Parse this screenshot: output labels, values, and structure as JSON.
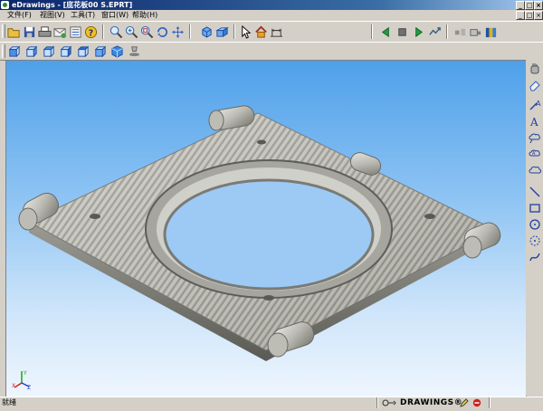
{
  "window": {
    "title": "eDrawings - [底花板00 S.EPRT]",
    "min_glyph": "_",
    "max_glyph": "□",
    "close_glyph": "×"
  },
  "menu": {
    "items": [
      "文件(F)",
      "视图(V)",
      "工具(T)",
      "窗口(W)",
      "帮助(H)"
    ],
    "mdi_min": "_",
    "mdi_max": "□",
    "mdi_close": "×"
  },
  "toolbar": {
    "main": [
      "open-icon",
      "save-icon",
      "print-icon",
      "send-icon",
      "options-icon",
      "help-icon",
      "zoom-fit-icon",
      "zoom-in-icon",
      "zoom-area-icon",
      "rotate-icon",
      "pan-icon",
      "view-3d-icon",
      "view-orient-icon",
      "select-icon",
      "home-icon",
      "measure-icon"
    ],
    "animation": [
      "play-back-icon",
      "stop-icon",
      "play-icon",
      "loop-icon"
    ],
    "misc": [
      "explode-icon",
      "section-icon",
      "gallery-icon"
    ],
    "views": [
      "view-front-icon",
      "view-back-icon",
      "view-left-icon",
      "view-right-icon",
      "view-top-icon",
      "view-bottom-icon",
      "view-iso-icon",
      "shadow-icon"
    ]
  },
  "markup_tools": [
    "hand-icon",
    "eraser-icon",
    "leader-icon",
    "text-icon",
    "cloud-icon",
    "cloud-leader-icon",
    "cloud-shape-icon",
    "line-icon",
    "rectangle-icon",
    "circle-icon",
    "arc-icon",
    "spline-icon"
  ],
  "status": {
    "text": "就绪",
    "brand": "DRAWINGS®"
  },
  "triad": {
    "x": "X",
    "y": "Y",
    "z": "Z"
  }
}
